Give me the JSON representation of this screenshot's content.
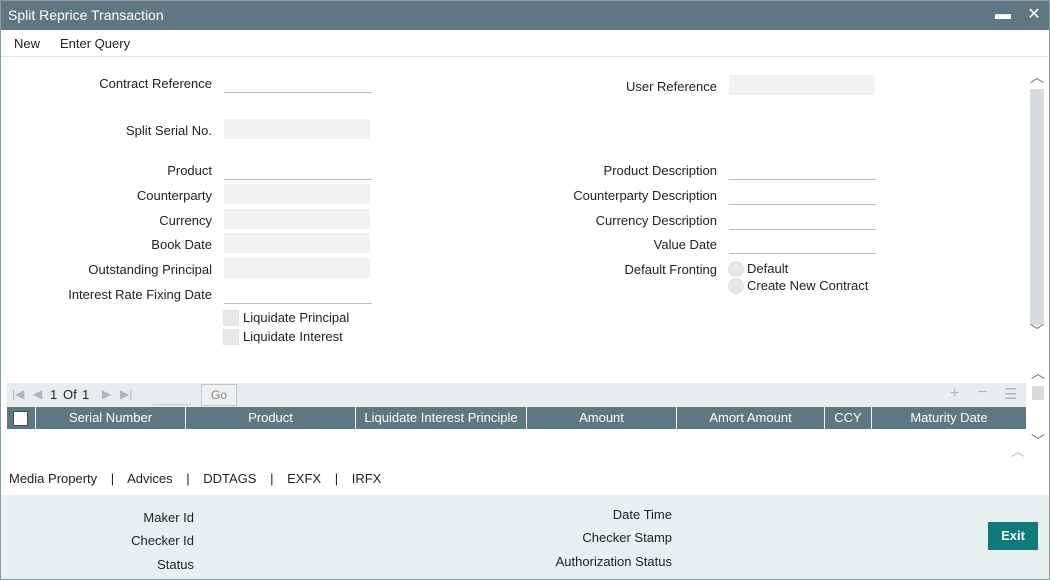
{
  "window": {
    "title": "Split Reprice Transaction",
    "minimize_icon": "minimize-icon",
    "close_icon": "close-icon"
  },
  "menu": {
    "new_label": "New",
    "enter_query_label": "Enter Query"
  },
  "form": {
    "contract_reference": {
      "label": "Contract Reference",
      "value": ""
    },
    "user_reference": {
      "label": "User Reference",
      "value": ""
    },
    "split_serial_no": {
      "label": "Split Serial No.",
      "value": ""
    },
    "product": {
      "label": "Product",
      "value": ""
    },
    "product_description": {
      "label": "Product Description",
      "value": ""
    },
    "counterparty": {
      "label": "Counterparty",
      "value": ""
    },
    "counterparty_description": {
      "label": "Counterparty Description",
      "value": ""
    },
    "currency": {
      "label": "Currency",
      "value": ""
    },
    "currency_description": {
      "label": "Currency Description",
      "value": ""
    },
    "book_date": {
      "label": "Book Date",
      "value": ""
    },
    "value_date": {
      "label": "Value Date",
      "value": ""
    },
    "outstanding_principal": {
      "label": "Outstanding Principal",
      "value": ""
    },
    "default_fronting": {
      "label": "Default Fronting",
      "options": [
        "Default",
        "Create New Contract"
      ]
    },
    "interest_rate_fixing_date": {
      "label": "Interest Rate Fixing Date",
      "value": ""
    },
    "liquidate_principal": {
      "label": "Liquidate Principal",
      "checked": false
    },
    "liquidate_interest": {
      "label": "Liquidate Interest",
      "checked": false
    }
  },
  "grid": {
    "pagination": {
      "current": "1",
      "of_label": "Of",
      "total": "1",
      "go_label": "Go"
    },
    "columns": [
      "Serial Number",
      "Product",
      "Liquidate Interest Principle",
      "Amount",
      "Amort Amount",
      "CCY",
      "Maturity Date"
    ],
    "rows": []
  },
  "tabs": [
    "Media Property",
    "Advices",
    "DDTAGS",
    "EXFX",
    "IRFX"
  ],
  "tab_separator": "|",
  "footer": {
    "maker_id": "Maker Id",
    "checker_id": "Checker Id",
    "status": "Status",
    "date_time": "Date Time",
    "checker_stamp": "Checker Stamp",
    "authorization_status": "Authorization Status",
    "exit_label": "Exit"
  },
  "colors": {
    "titlebar": "#5f7782",
    "exit_button": "#10797a",
    "footer_bg": "#e8f1f2"
  }
}
